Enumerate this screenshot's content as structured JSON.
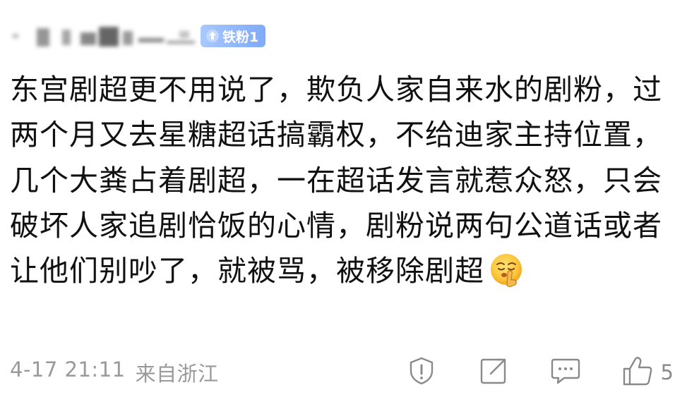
{
  "comment": {
    "fan_badge": {
      "label": "铁粉1",
      "icon": "fan-badge-icon",
      "color_start": "#a8c8ff",
      "color_end": "#7faaf6"
    },
    "text": "东宫剧超更不用说了，欺负人家自来水的剧粉，过两个月又去星糖超话搞霸权，不给迪家主持位置，几个大粪占着剧超，一在超话发言就惹众怒，只会破坏人家追剧恰饭的心情，剧粉说两句公道话或者让他们别吵了，就被骂，被移除剧超",
    "emoji": "shushing-face-emoji",
    "date": "4-17 21:11",
    "location": "来自浙江",
    "actions": {
      "report_icon": "report-icon",
      "share_icon": "share-icon",
      "comment_icon": "comment-icon",
      "like_icon": "thumbs-up-icon",
      "like_count": "5"
    },
    "colors": {
      "text": "#111111",
      "meta": "#9a9a9a",
      "icon": "#8a8a8a"
    }
  }
}
